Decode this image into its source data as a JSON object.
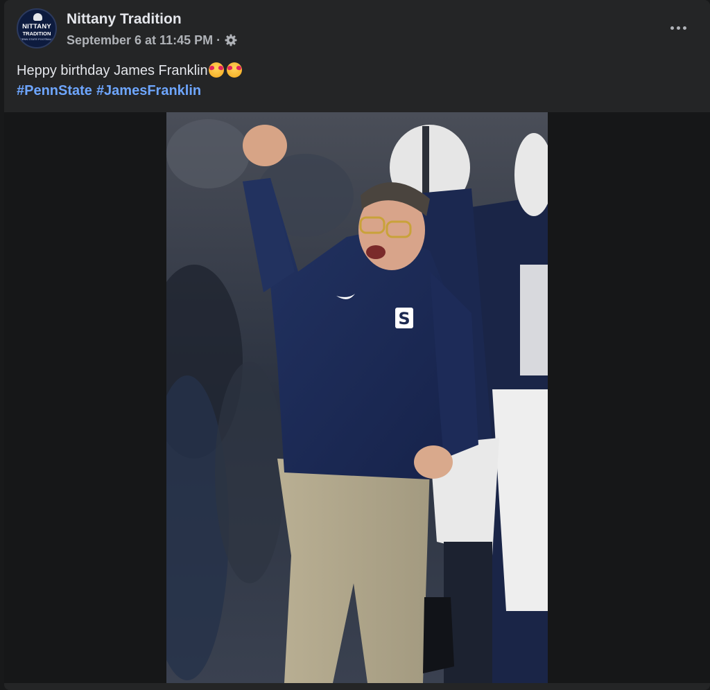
{
  "post": {
    "page_name": "Nittany Tradition",
    "timestamp": "September 6 at 11:45 PM",
    "separator": "·",
    "privacy_icon": "gear-icon",
    "more_icon": "more-options-icon",
    "avatar_logo": {
      "line1": "NITTANY",
      "line2": "TRADITION",
      "line3": "PENN STATE FOOTBALL"
    },
    "text": "Heppy birthday James Franklin",
    "emoji_icons": [
      "smiling-face-with-hearts-icon",
      "smiling-face-with-hearts-icon"
    ],
    "hashtags": [
      "#PennState",
      "#JamesFranklin"
    ],
    "photo_icon": "coach-celebrating-photo"
  },
  "colors": {
    "background": "#18191a",
    "card": "#242526",
    "primary_text": "#e4e6eb",
    "secondary_text": "#b0b3b8",
    "hashtag": "#6ea6ff",
    "navy": "#1c2a52"
  }
}
